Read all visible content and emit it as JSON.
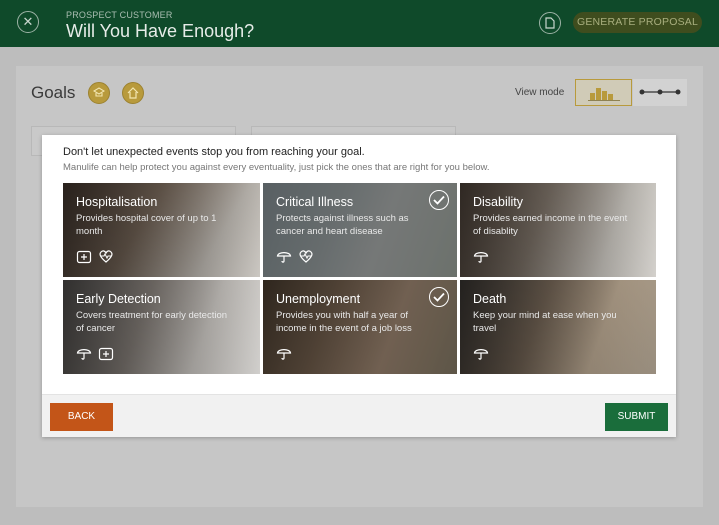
{
  "header": {
    "eyebrow": "PROSPECT CUSTOMER",
    "title": "Will You Have Enough?",
    "generate_label": "GENERATE PROPOSAL"
  },
  "page": {
    "goals_title": "Goals",
    "view_mode_label": "View mode"
  },
  "modal": {
    "heading": "Don't let unexpected events stop you from reaching your goal.",
    "subheading": "Manulife can help protect you against every eventuality, just pick the ones that are right for you below.",
    "tiles": [
      {
        "title": "Hospitalisation",
        "desc": "Provides hospital cover of up to 1 month",
        "selected": false,
        "icons": [
          "hospital-icon",
          "heartbeat-icon"
        ]
      },
      {
        "title": "Critical Illness",
        "desc": "Protects against illness such as cancer and heart disease",
        "selected": true,
        "icons": [
          "umbrella-icon",
          "heartbeat-icon"
        ]
      },
      {
        "title": "Disability",
        "desc": "Provides earned income in the event of disablity",
        "selected": false,
        "icons": [
          "umbrella-icon"
        ]
      },
      {
        "title": "Early Detection",
        "desc": "Covers treatment for early detection of cancer",
        "selected": false,
        "icons": [
          "umbrella-icon",
          "hospital-icon"
        ]
      },
      {
        "title": "Unemployment",
        "desc": "Provides you with half a year of income in the event of a job loss",
        "selected": true,
        "icons": [
          "umbrella-icon"
        ]
      },
      {
        "title": "Death",
        "desc": "Keep your mind at ease when you travel",
        "selected": false,
        "icons": [
          "umbrella-icon"
        ]
      }
    ],
    "back_label": "BACK",
    "submit_label": "SUBMIT"
  },
  "colors": {
    "header_bg": "#0f4a2a",
    "back_button": "#c35518",
    "submit_button": "#1a6d3b",
    "gold_accent": "#b89a3c"
  }
}
